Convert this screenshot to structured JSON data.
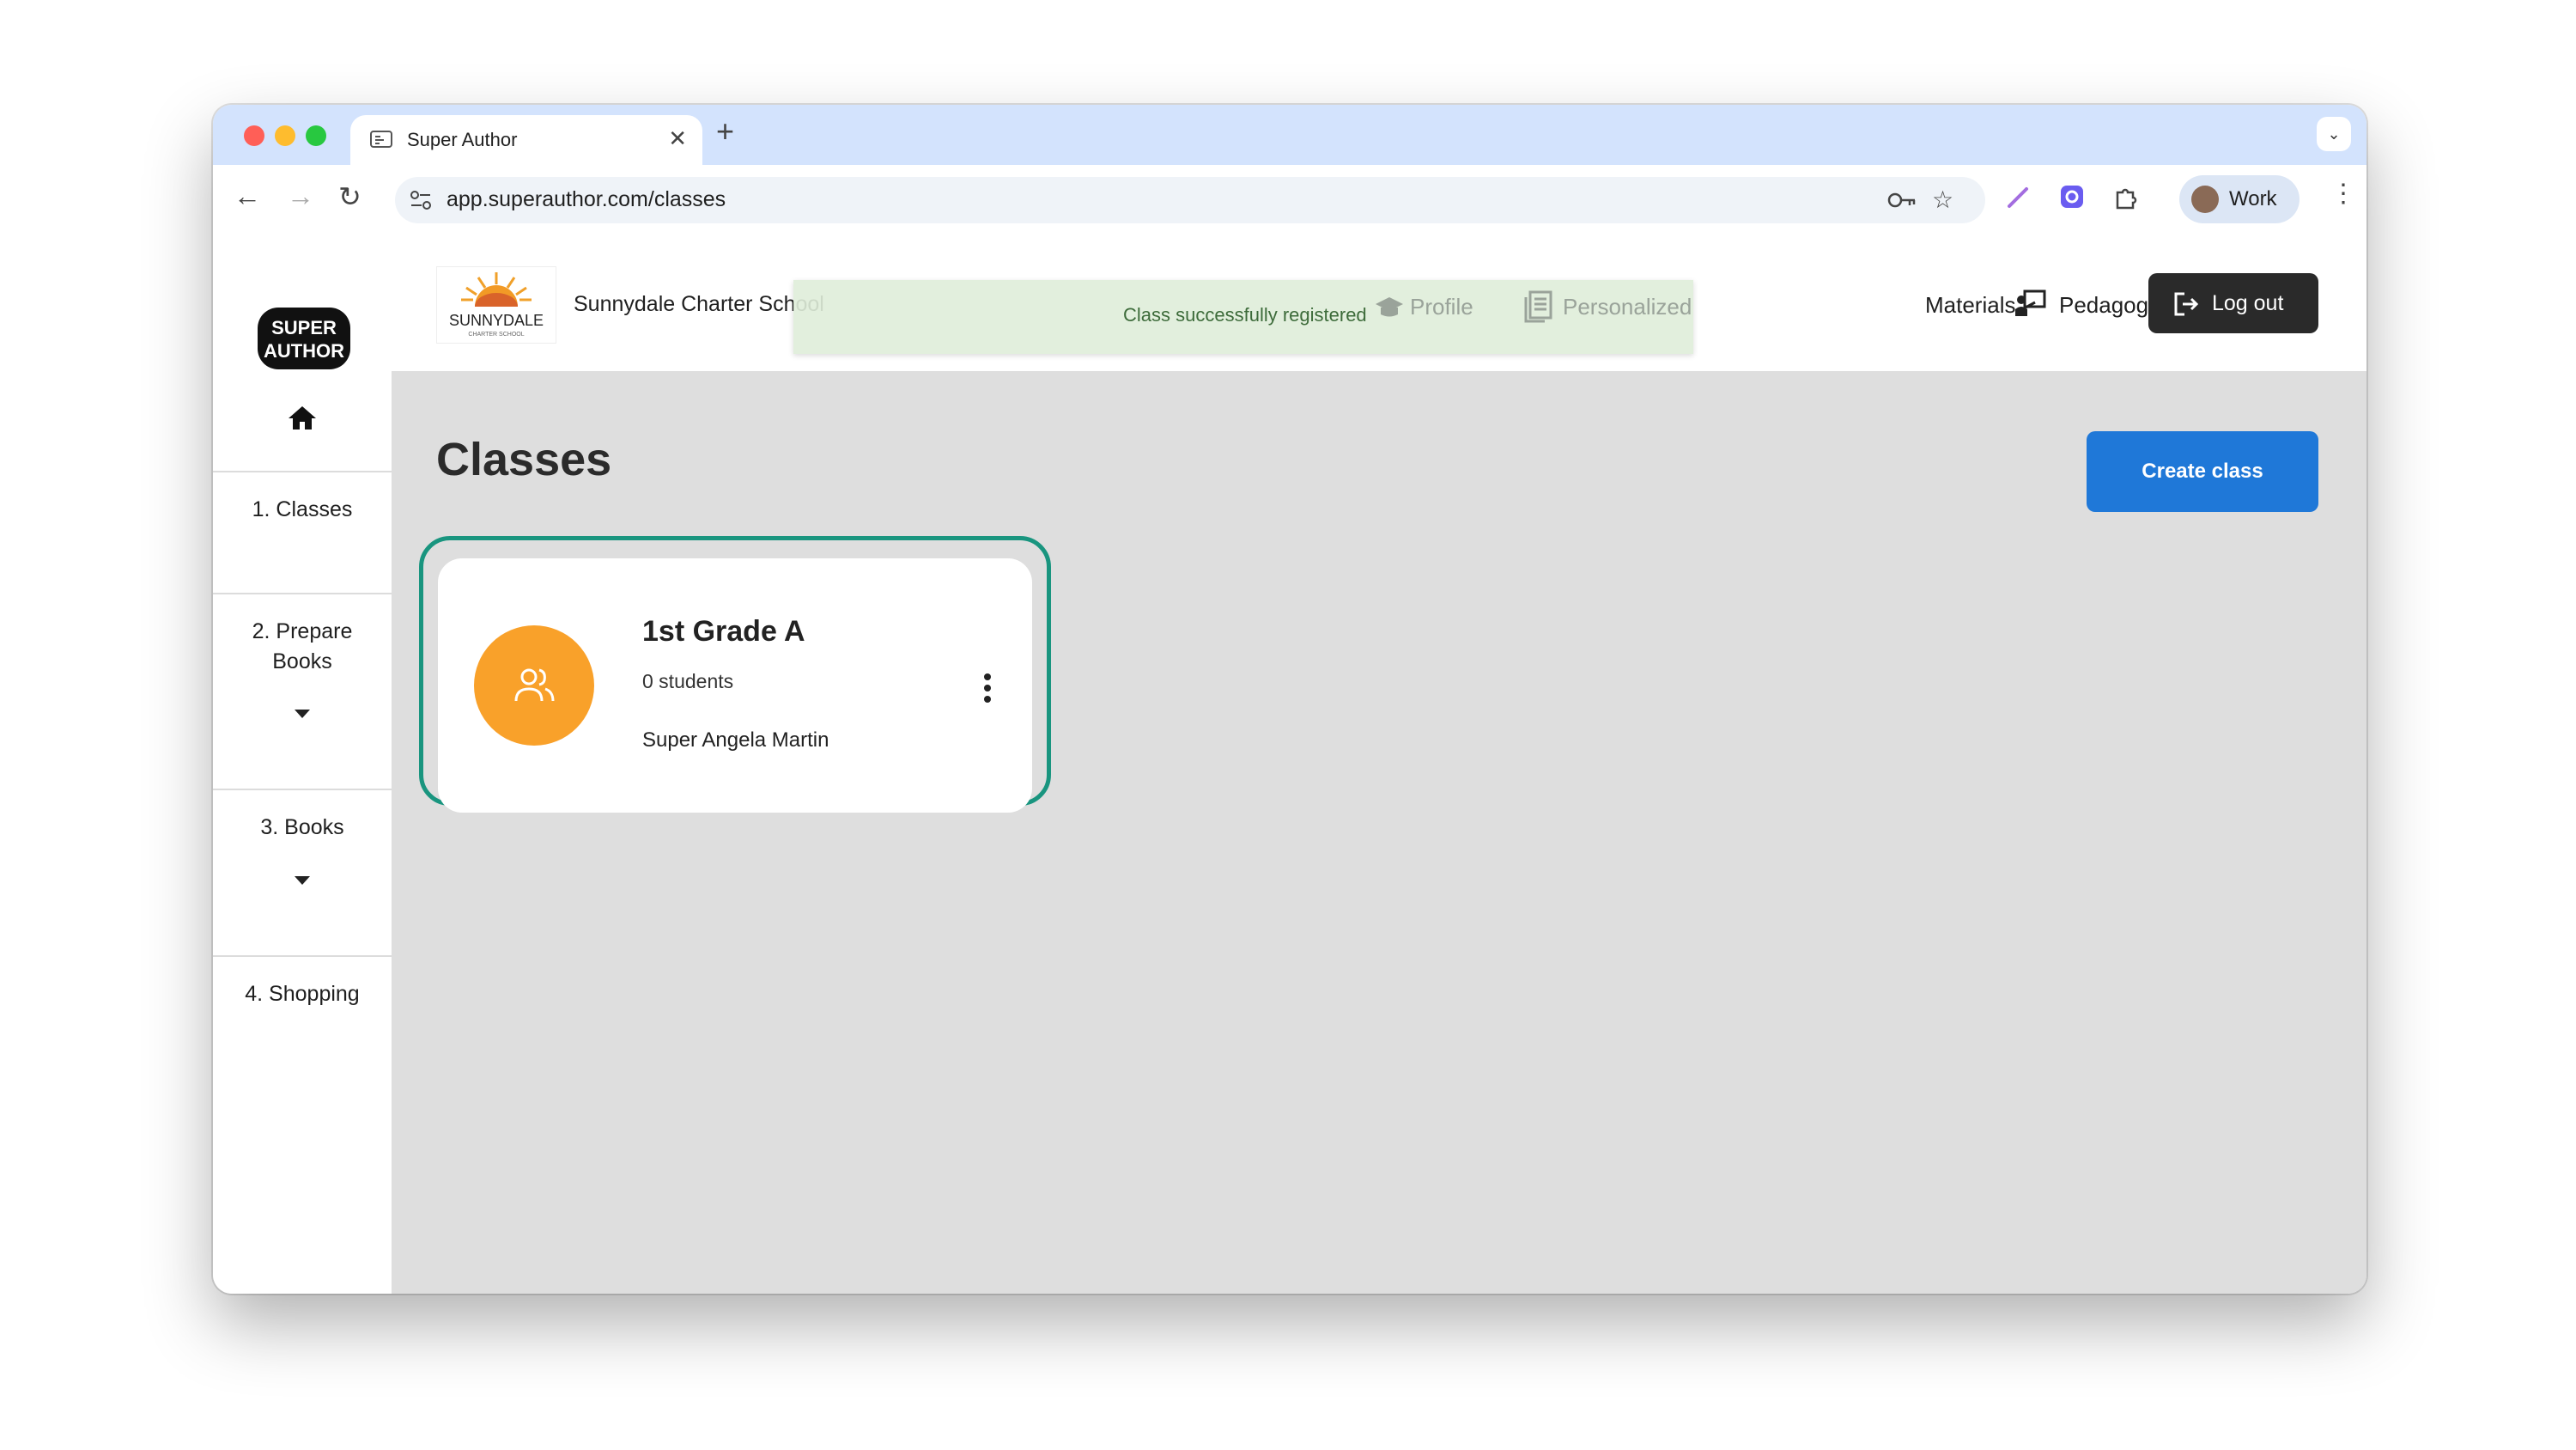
{
  "browser": {
    "tab_title": "Super Author",
    "url": "app.superauthor.com/classes",
    "profile_label": "Work"
  },
  "sidebar": {
    "logo_text": "SUPER AUTHOR",
    "items": [
      {
        "label": "1. Classes"
      },
      {
        "label": "2. Prepare Books"
      },
      {
        "label": "3. Books"
      },
      {
        "label": "4. Shopping"
      }
    ]
  },
  "header": {
    "school_logo_text": "SUNNYDALE",
    "school_logo_subtext": "CHARTER SCHOOL",
    "school_name": "Sunnydale Charter School",
    "nav": {
      "profile": "Profile",
      "personalized_prefix": "Personalized",
      "materials_suffix": "Materials",
      "pedagogical": "Pedagogical Resources"
    },
    "logout_label": "Log out"
  },
  "toast": {
    "message": "Class successfully registered"
  },
  "main": {
    "title": "Classes",
    "create_button": "Create class",
    "classes": [
      {
        "name": "1st Grade A",
        "students": "0 students",
        "teacher": "Super Angela Martin"
      }
    ]
  },
  "colors": {
    "accent_blue": "#1f78d8",
    "highlight_teal": "#19957f",
    "class_avatar_orange": "#f9a12a",
    "toast_green": "#dfedd9"
  }
}
